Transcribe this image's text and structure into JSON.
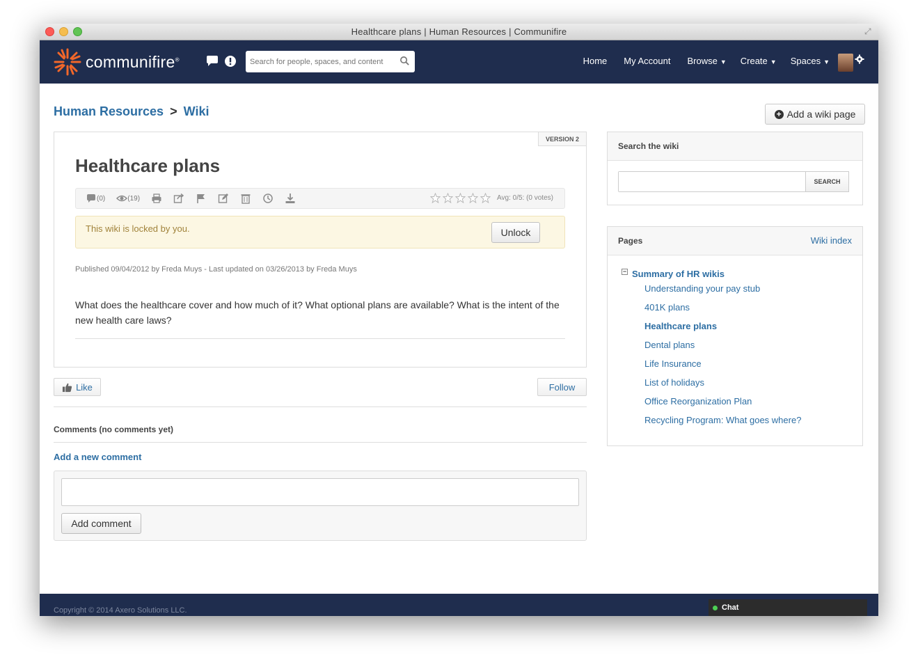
{
  "window": {
    "title": "Healthcare plans | Human Resources | Communifire"
  },
  "nav": {
    "brand": "communifire",
    "brand_mark": "®",
    "search_placeholder": "Search for people, spaces, and content",
    "items": [
      {
        "label": "Home",
        "caret": ""
      },
      {
        "label": "My Account",
        "caret": ""
      },
      {
        "label": "Browse",
        "caret": "▼"
      },
      {
        "label": "Create",
        "caret": "▼"
      },
      {
        "label": "Spaces",
        "caret": "▼"
      }
    ]
  },
  "breadcrumb": {
    "space": "Human Resources",
    "sep": ">",
    "section": "Wiki"
  },
  "add_wiki_label": "Add a wiki page",
  "article": {
    "version": "VERSION 2",
    "title": "Healthcare plans",
    "comment_count": "(0)",
    "view_count": "(19)",
    "rating_text": "Avg: 0/5: (0 votes)",
    "locked_text": "This wiki is locked by you.",
    "unlock_label": "Unlock",
    "published": "Published 09/04/2012 by Freda Muys - Last updated on 03/26/2013 by Freda Muys",
    "body": "What does the healthcare cover and how much of it? What optional plans are available? What is the intent of the new health care laws?"
  },
  "actions": {
    "like": "Like",
    "follow": "Follow"
  },
  "comments": {
    "header": "Comments (no comments yet)",
    "add_link": "Add a new comment",
    "button": "Add comment"
  },
  "sidebar": {
    "search_title": "Search the wiki",
    "search_button": "SEARCH",
    "pages_title": "Pages",
    "wiki_index": "Wiki index",
    "root": "Summary of HR wikis",
    "pages": [
      "Understanding your pay stub",
      "401K plans",
      "Healthcare plans",
      "Dental plans",
      "Life Insurance",
      "List of holidays",
      "Office Reorganization Plan",
      "Recycling Program: What goes where?"
    ]
  },
  "footer": {
    "copyright": "Copyright © 2014 Axero Solutions LLC.",
    "chat": "Chat"
  }
}
